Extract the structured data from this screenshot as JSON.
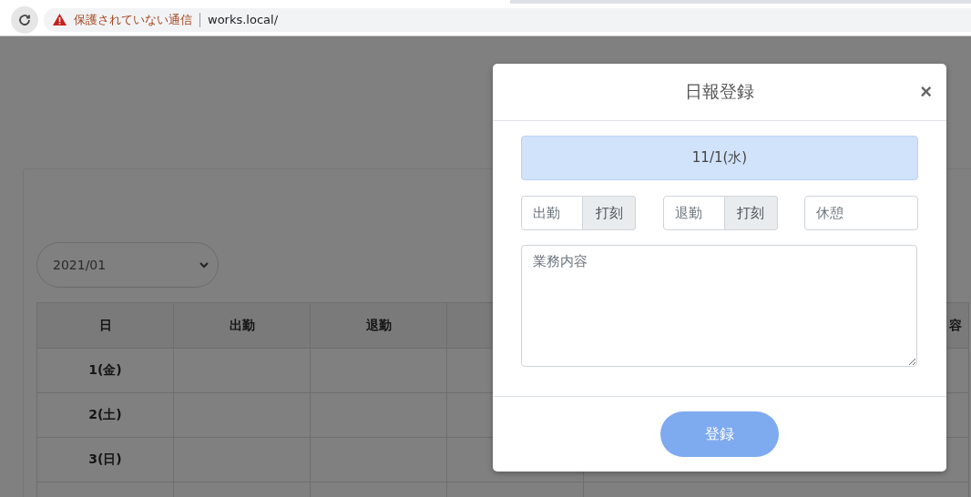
{
  "browser": {
    "security_label": "保護されていない通信",
    "url": "works.local/"
  },
  "page": {
    "month_select": {
      "value": "2021/01"
    },
    "table": {
      "columns": [
        {
          "label": "日"
        },
        {
          "label": "出勤"
        },
        {
          "label": "退勤"
        },
        {},
        {
          "label": "容"
        }
      ],
      "rows": [
        {
          "day": "1(金)"
        },
        {
          "day": "2(土)"
        },
        {
          "day": "3(日)"
        },
        {}
      ]
    }
  },
  "modal": {
    "title": "日報登録",
    "close": "×",
    "date": "11/1(水)",
    "clock_in": {
      "placeholder": "出勤",
      "button": "打刻"
    },
    "clock_out": {
      "placeholder": "退勤",
      "button": "打刻"
    },
    "break": {
      "placeholder": "休憩"
    },
    "report": {
      "placeholder": "業務内容"
    },
    "submit": "登録"
  }
}
